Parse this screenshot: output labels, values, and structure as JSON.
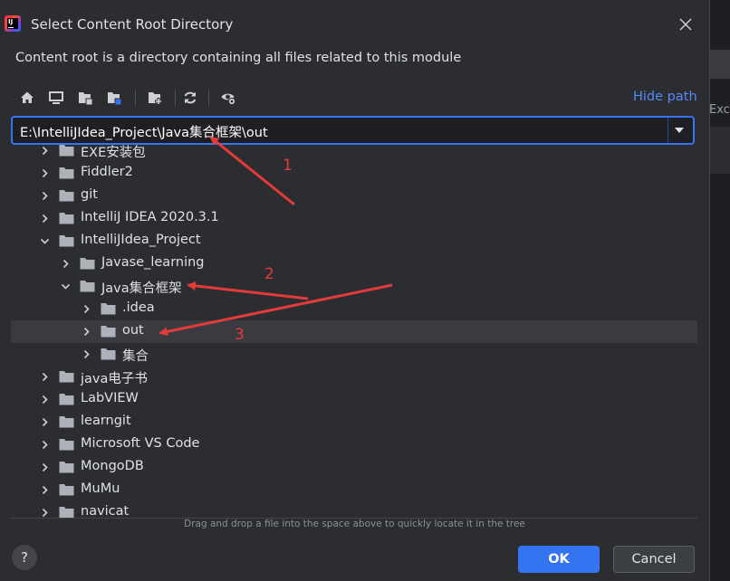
{
  "dialog": {
    "title": "Select Content Root Directory",
    "subtitle": "Content root is a directory containing all files related to this module",
    "hide_path": "Hide path",
    "path_value": "E:\\IntelliJIdea_Project\\Java集合框架\\out",
    "drag_hint": "Drag and drop a file into the space above to quickly locate it in the tree",
    "help": "?",
    "ok": "OK",
    "cancel": "Cancel"
  },
  "background": {
    "partial_text": "Exc"
  },
  "toolbar": {
    "icons": [
      "home-icon",
      "desktop-icon",
      "project-folder-icon",
      "module-folder-icon",
      "new-folder-icon",
      "refresh-icon",
      "show-hidden-icon"
    ]
  },
  "tree": {
    "items": [
      {
        "label": "EXE安装包",
        "expanded": false
      },
      {
        "label": "Fiddler2",
        "expanded": false
      },
      {
        "label": "git",
        "expanded": false
      },
      {
        "label": "IntelliJ IDEA 2020.3.1",
        "expanded": false
      },
      {
        "label": "IntelliJIdea_Project",
        "expanded": true
      },
      {
        "label": "Javase_learning",
        "expanded": false
      },
      {
        "label": "Java集合框架",
        "expanded": true
      },
      {
        "label": ".idea",
        "expanded": false
      },
      {
        "label": "out",
        "expanded": false,
        "selected": true
      },
      {
        "label": "集合",
        "expanded": false
      },
      {
        "label": "java电子书",
        "expanded": false
      },
      {
        "label": "LabVIEW",
        "expanded": false
      },
      {
        "label": "learngit",
        "expanded": false
      },
      {
        "label": "Microsoft VS Code",
        "expanded": false
      },
      {
        "label": "MongoDB",
        "expanded": false
      },
      {
        "label": "MuMu",
        "expanded": false
      },
      {
        "label": "navicat",
        "expanded": false
      }
    ]
  },
  "annotations": {
    "labels": [
      "1",
      "2",
      "3"
    ],
    "color": "#e33a3a"
  },
  "colors": {
    "accent": "#3574f0",
    "link": "#548af7",
    "background": "#2b2d30",
    "annotation": "#e33a3a"
  }
}
